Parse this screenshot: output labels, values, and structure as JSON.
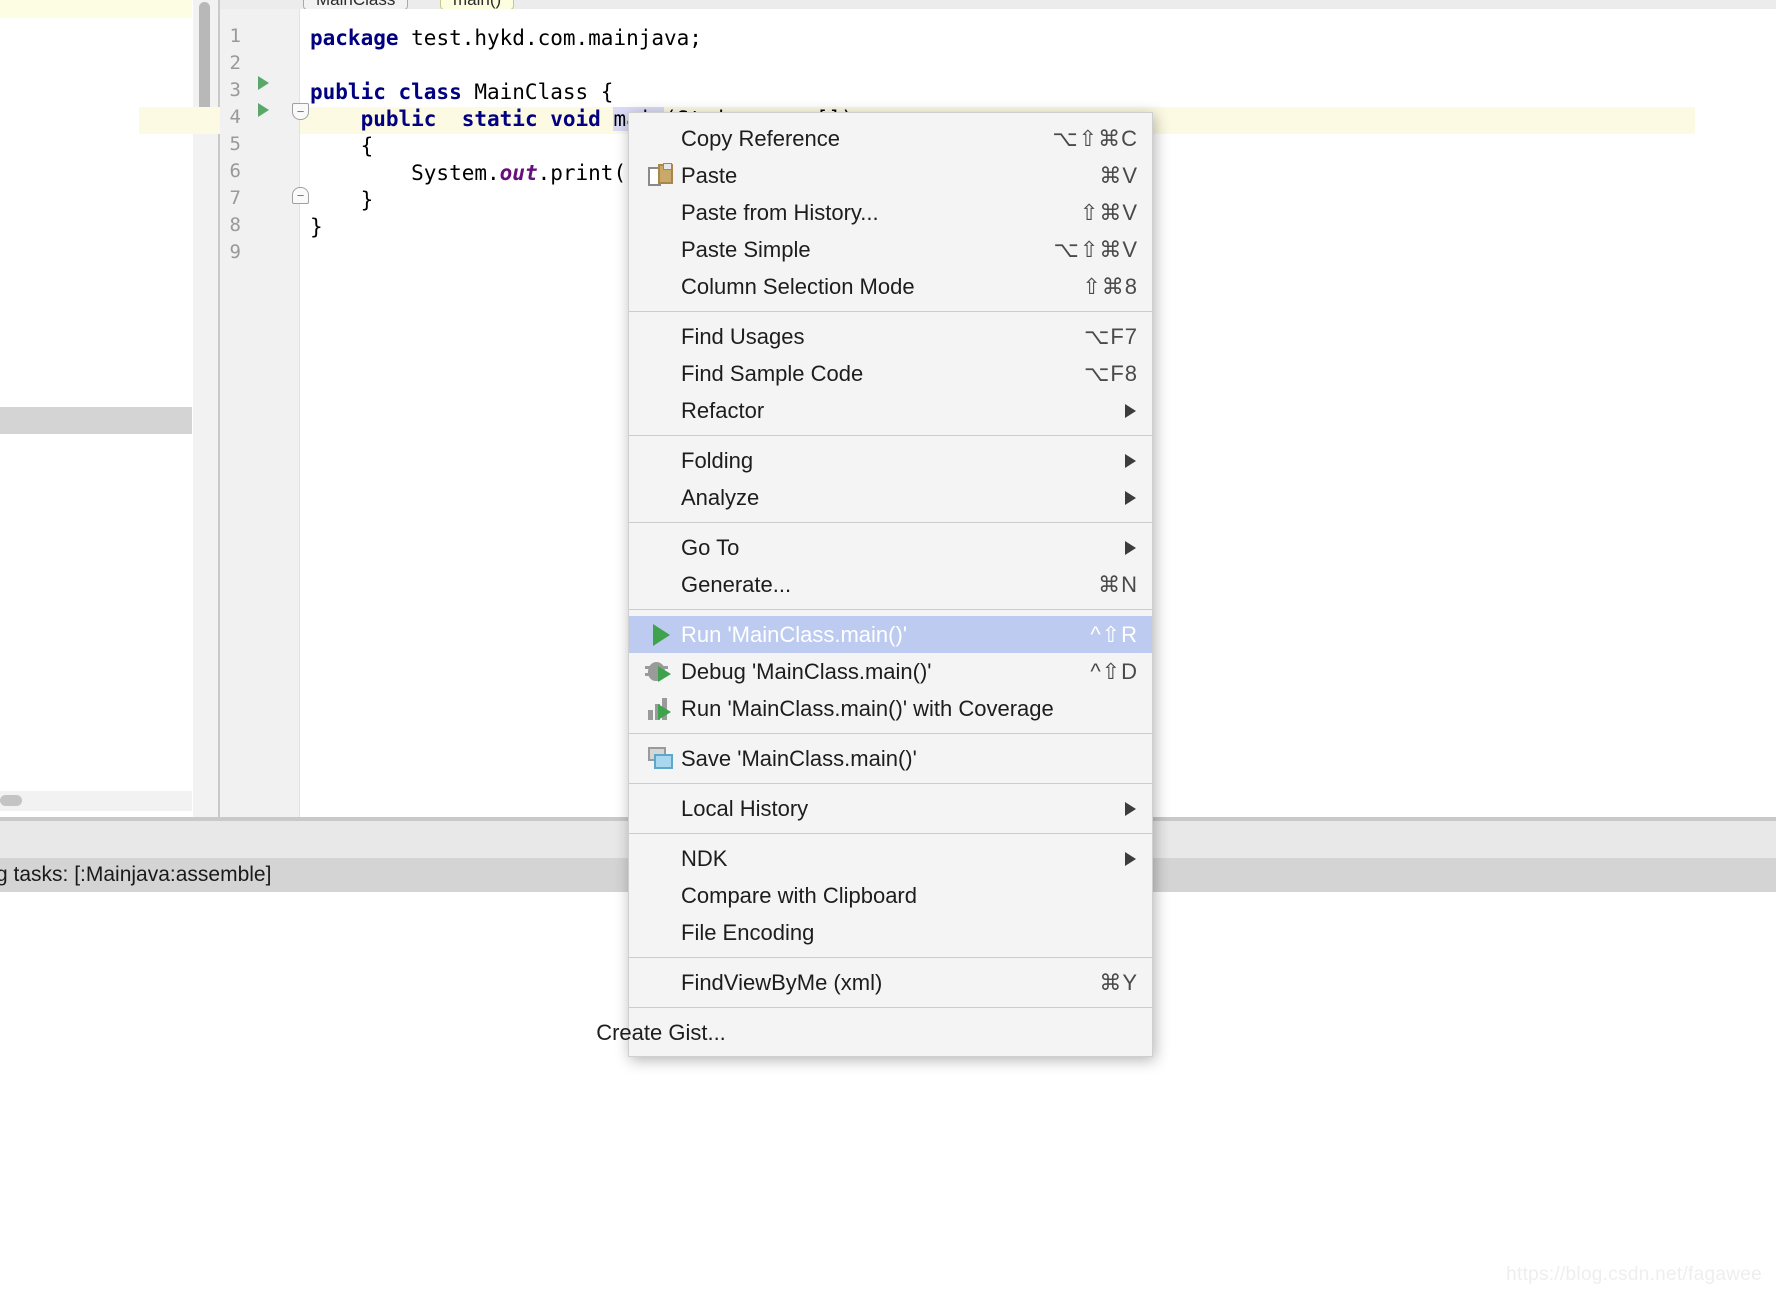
{
  "window": {
    "watermark": "https://blog.csdn.net/fagawee"
  },
  "tabs": [
    {
      "label": "MainClass",
      "active": false
    },
    {
      "label": "main()",
      "active": true
    }
  ],
  "editor": {
    "language": "java",
    "line_numbers": [
      "1",
      "2",
      "3",
      "4",
      "5",
      "6",
      "7",
      "8",
      "9"
    ],
    "lines": [
      {
        "n": "1",
        "text": "package test.hykd.com.mainjava;"
      },
      {
        "n": "2",
        "text": ""
      },
      {
        "n": "3",
        "text": "public class MainClass {"
      },
      {
        "n": "4",
        "text": "    public  static void main(String args[])"
      },
      {
        "n": "5",
        "text": "    {"
      },
      {
        "n": "6",
        "text": "        System.out.print(\"hello_world!\");"
      },
      {
        "n": "7",
        "text": "    }"
      },
      {
        "n": "8",
        "text": "}"
      },
      {
        "n": "9",
        "text": ""
      }
    ],
    "caret_line": "4",
    "selected_identifier": "main"
  },
  "status": {
    "text": "g tasks: [:Mainjava:assemble]"
  },
  "context_menu": {
    "groups": [
      {
        "items": [
          {
            "label": "Copy Reference",
            "shortcut": "⌥⇧⌘C",
            "icon": null,
            "submenu": false,
            "selected": false
          },
          {
            "label": "Paste",
            "shortcut": "⌘V",
            "icon": "paste-icon",
            "submenu": false,
            "selected": false
          },
          {
            "label": "Paste from History...",
            "shortcut": "⇧⌘V",
            "icon": null,
            "submenu": false,
            "selected": false
          },
          {
            "label": "Paste Simple",
            "shortcut": "⌥⇧⌘V",
            "icon": null,
            "submenu": false,
            "selected": false
          },
          {
            "label": "Column Selection Mode",
            "shortcut": "⇧⌘8",
            "icon": null,
            "submenu": false,
            "selected": false
          }
        ]
      },
      {
        "items": [
          {
            "label": "Find Usages",
            "shortcut": "⌥F7",
            "icon": null,
            "submenu": false,
            "selected": false
          },
          {
            "label": "Find Sample Code",
            "shortcut": "⌥F8",
            "icon": null,
            "submenu": false,
            "selected": false
          },
          {
            "label": "Refactor",
            "shortcut": "",
            "icon": null,
            "submenu": true,
            "selected": false
          }
        ]
      },
      {
        "items": [
          {
            "label": "Folding",
            "shortcut": "",
            "icon": null,
            "submenu": true,
            "selected": false
          },
          {
            "label": "Analyze",
            "shortcut": "",
            "icon": null,
            "submenu": true,
            "selected": false
          }
        ]
      },
      {
        "items": [
          {
            "label": "Go To",
            "shortcut": "",
            "icon": null,
            "submenu": true,
            "selected": false
          },
          {
            "label": "Generate...",
            "shortcut": "⌘N",
            "icon": null,
            "submenu": false,
            "selected": false
          }
        ]
      },
      {
        "items": [
          {
            "label": "Run 'MainClass.main()'",
            "shortcut": "^⇧R",
            "icon": "run-icon",
            "submenu": false,
            "selected": true
          },
          {
            "label": "Debug 'MainClass.main()'",
            "shortcut": "^⇧D",
            "icon": "debug-icon",
            "submenu": false,
            "selected": false
          },
          {
            "label": "Run 'MainClass.main()' with Coverage",
            "shortcut": "",
            "icon": "coverage-icon",
            "submenu": false,
            "selected": false
          }
        ]
      },
      {
        "items": [
          {
            "label": "Save 'MainClass.main()'",
            "shortcut": "",
            "icon": "save-icon",
            "submenu": false,
            "selected": false
          }
        ]
      },
      {
        "items": [
          {
            "label": "Local History",
            "shortcut": "",
            "icon": null,
            "submenu": true,
            "selected": false
          }
        ]
      },
      {
        "items": [
          {
            "label": "NDK",
            "shortcut": "",
            "icon": null,
            "submenu": true,
            "selected": false
          },
          {
            "label": "Compare with Clipboard",
            "shortcut": "",
            "icon": null,
            "submenu": false,
            "selected": false
          },
          {
            "label": "File Encoding",
            "shortcut": "",
            "icon": null,
            "submenu": false,
            "selected": false
          }
        ]
      },
      {
        "items": [
          {
            "label": "FindViewByMe (xml)",
            "shortcut": "⌘Y",
            "icon": null,
            "submenu": false,
            "selected": false
          }
        ]
      },
      {
        "items": [
          {
            "label": "Create Gist...",
            "shortcut": "",
            "icon": "github-icon",
            "submenu": false,
            "selected": false
          }
        ]
      }
    ]
  }
}
